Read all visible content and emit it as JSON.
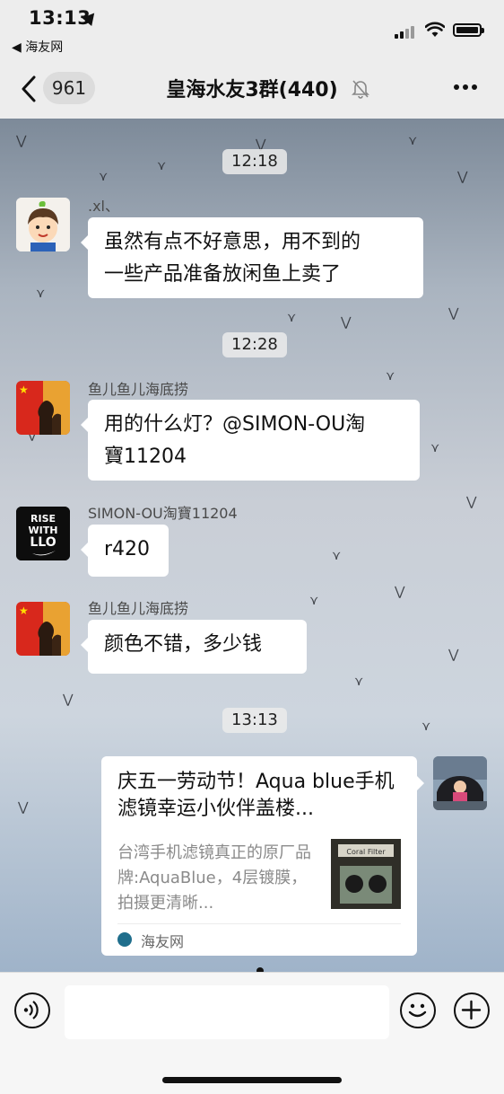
{
  "status_bar": {
    "time": "13:13",
    "back_app": "◀ 海友网"
  },
  "nav": {
    "unread_count": "961",
    "title": "皇海水友3群(440)"
  },
  "messages": [
    {
      "type": "timestamp",
      "text": "12:18"
    },
    {
      "type": "incoming",
      "sender": ".xl、",
      "text_lines": [
        "虽然有点不好意思，用不到的",
        "一些产品准备放闲鱼上卖了"
      ]
    },
    {
      "type": "timestamp",
      "text": "12:28"
    },
    {
      "type": "incoming",
      "sender": "鱼儿鱼儿海底捞",
      "text_lines": [
        "用的什么灯？@SIMON-OU淘",
        "寶11204"
      ]
    },
    {
      "type": "incoming",
      "sender": "SIMON-OU淘寶11204",
      "text_lines": [
        "r420"
      ]
    },
    {
      "type": "incoming",
      "sender": "鱼儿鱼儿海底捞",
      "text_lines": [
        "颜色不错，多少钱"
      ]
    },
    {
      "type": "timestamp",
      "text": "13:13"
    },
    {
      "type": "outgoing_card",
      "card_title": "庆五一劳动节！Aqua blue手机滤镜幸运小伙伴盖楼...",
      "card_description": "台湾手机滤镜真正的原厂品牌:AquaBlue，4层镀膜，拍摄更清晰...",
      "card_thumb_caption": "Coral Filter",
      "card_source": "海友网"
    }
  ],
  "avatars": {
    "xl": "cartoon-boy-avatar",
    "yuer": "flag-silhouette-avatar",
    "simon": "rise-with-llo-avatar",
    "self": "photo-avatar"
  },
  "colors": {
    "nav_background": "#ededed",
    "bubble_background": "#ffffff",
    "input_bar_background": "#f6f6f6"
  }
}
